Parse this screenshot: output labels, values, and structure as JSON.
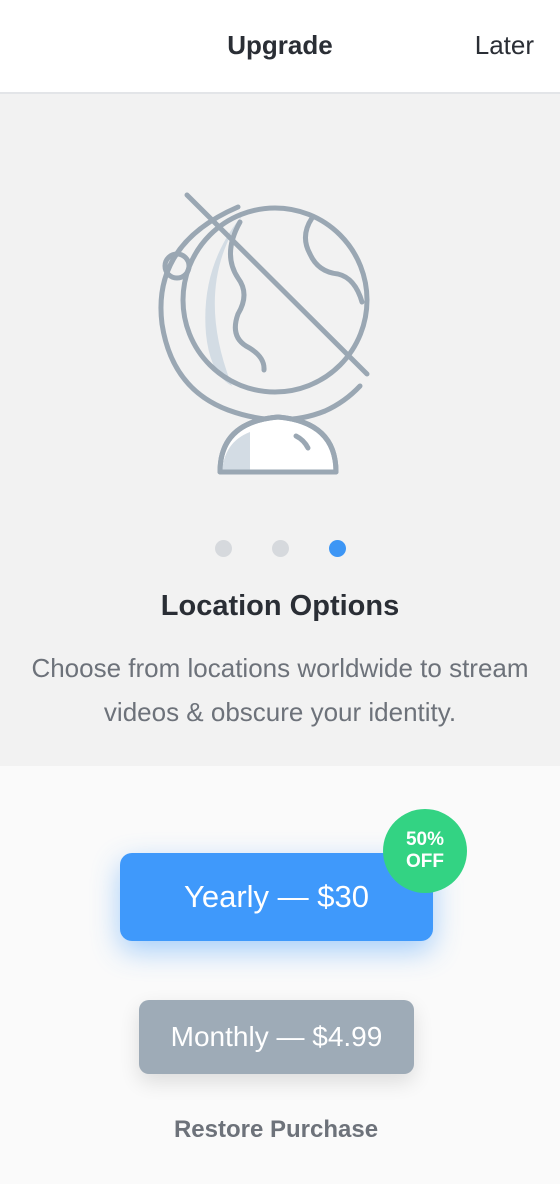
{
  "header": {
    "title": "Upgrade",
    "later_label": "Later"
  },
  "hero": {
    "icon": "globe-icon",
    "pagination": {
      "total": 3,
      "active": 3
    },
    "feature_title": "Location Options",
    "feature_description": "Choose from locations worldwide to stream videos & obscure your identity."
  },
  "pricing": {
    "yearly_label": "Yearly — $30",
    "badge_line1": "50%",
    "badge_line2": "OFF",
    "monthly_label": "Monthly — $4.99",
    "restore_label": "Restore Purchase"
  },
  "colors": {
    "accent": "#3f99fb",
    "badge": "#33d383",
    "secondary": "#9eabb7",
    "text": "#2a2e35"
  }
}
